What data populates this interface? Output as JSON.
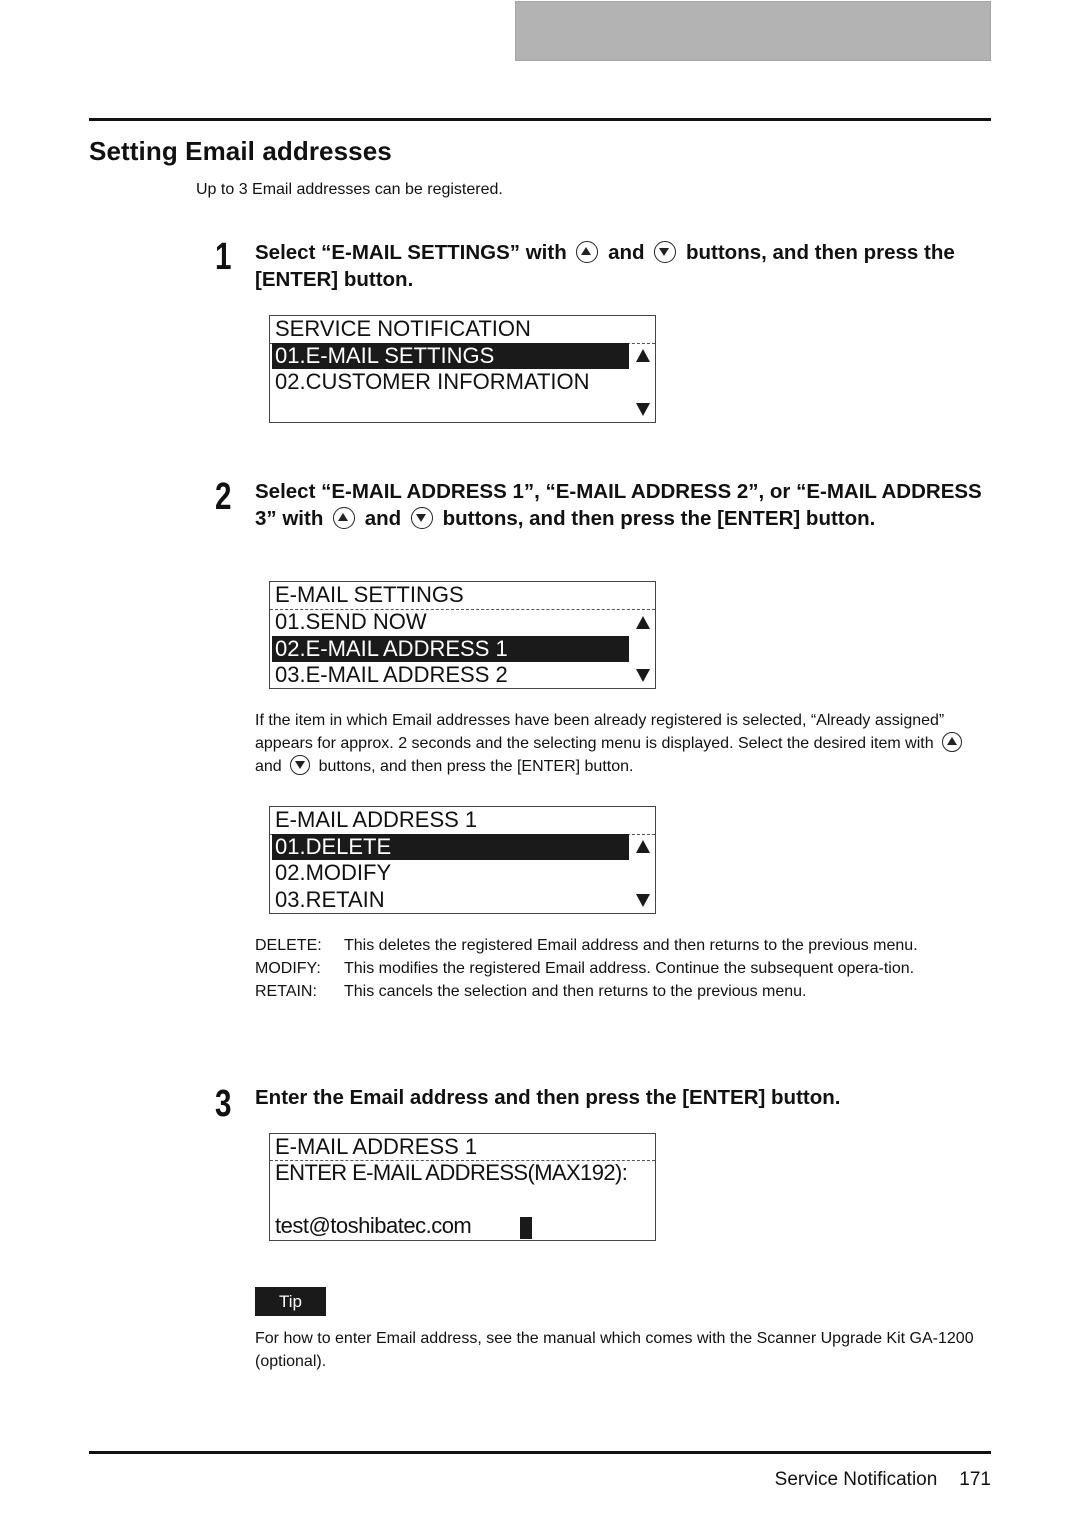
{
  "header": {
    "title": "Setting Email addresses",
    "intro": "Up to 3 Email addresses can be registered."
  },
  "icons": {
    "up": "up-button-icon",
    "down": "down-button-icon"
  },
  "steps": [
    {
      "number": "1",
      "text_a": "Select “E-MAIL SETTINGS” with",
      "text_and": "and",
      "text_b": "buttons, and then press the [ENTER] button.",
      "lcd": {
        "rows": [
          {
            "text": "SERVICE NOTIFICATION",
            "selected": false
          },
          {
            "text": "01.E-MAIL SETTINGS",
            "selected": true
          },
          {
            "text": "02.CUSTOMER INFORMATION",
            "selected": false
          },
          {
            "text": "",
            "selected": false
          }
        ]
      }
    },
    {
      "number": "2",
      "text_a": "Select “E-MAIL ADDRESS 1”, “E-MAIL ADDRESS 2”, or “E-MAIL ADDRESS 3” with",
      "text_and": "and",
      "text_b": "buttons, and then press the [ENTER] button.",
      "lcd": {
        "rows": [
          {
            "text": "E-MAIL SETTINGS",
            "selected": false
          },
          {
            "text": "01.SEND NOW",
            "selected": false
          },
          {
            "text": "02.E-MAIL ADDRESS 1",
            "selected": true
          },
          {
            "text": "03.E-MAIL ADDRESS 2",
            "selected": false
          }
        ]
      },
      "note_a": "If the item in which Email addresses have been already registered is selected, “Already assigned” appears for approx. 2 seconds and the selecting menu is displayed. Select the desired item with",
      "note_and": "and",
      "note_b": "buttons, and then press the [ENTER] button.",
      "lcd2": {
        "rows": [
          {
            "text": "E-MAIL ADDRESS 1",
            "selected": false
          },
          {
            "text": "01.DELETE",
            "selected": true
          },
          {
            "text": "02.MODIFY",
            "selected": false
          },
          {
            "text": "03.RETAIN",
            "selected": false
          }
        ]
      },
      "definitions": [
        {
          "term": "DELETE:",
          "desc": "This deletes the registered Email address and then returns to the previous menu."
        },
        {
          "term": "MODIFY:",
          "desc": "This modifies the registered Email address. Continue the subsequent opera-tion."
        },
        {
          "term": "RETAIN:",
          "desc": "This cancels the selection and then returns to the previous menu."
        }
      ]
    },
    {
      "number": "3",
      "text": "Enter the Email address and then press the [ENTER] button.",
      "lcd": {
        "title": "E-MAIL ADDRESS 1",
        "prompt": "ENTER E-MAIL ADDRESS(MAX192):",
        "value": "test@toshibatec.com"
      }
    }
  ],
  "tip": {
    "label": "Tip",
    "text": "For how to enter Email address, see the manual which comes with the Scanner Upgrade Kit GA-1200 (optional)."
  },
  "footer": {
    "section": "Service Notification",
    "page": "171"
  }
}
